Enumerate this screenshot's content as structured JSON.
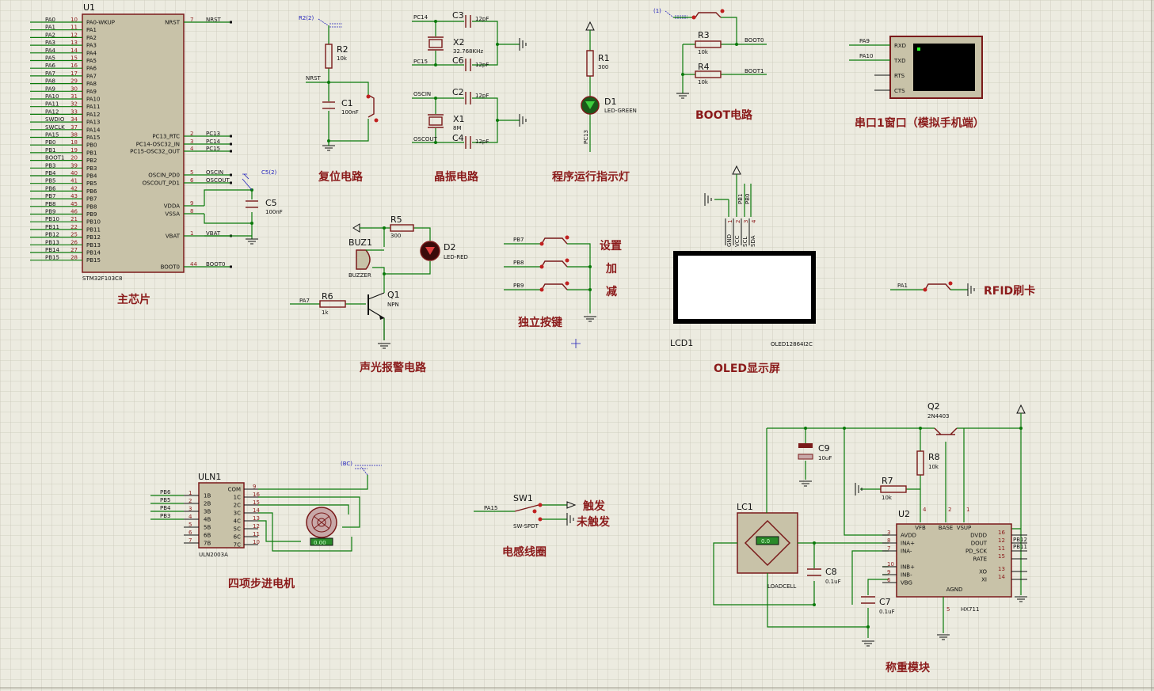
{
  "titles": {
    "main_chip": "主芯片",
    "reset": "复位电路",
    "crystal": "晶振电路",
    "run_led": "程序运行指示灯",
    "boot": "BOOT电路",
    "uart": "串口1窗口（模拟手机端）",
    "alarm": "声光报警电路",
    "keys": "独立按键",
    "oled": "OLED显示屏",
    "rfid": "RFID刷卡",
    "stepper": "四项步进电机",
    "coil": "电感线圈",
    "weigh": "称重模块"
  },
  "mcu": {
    "ref": "U1",
    "part": "STM32F103C8",
    "left_nets": [
      "PA0",
      "PA1",
      "PA2",
      "PA3",
      "PA4",
      "PA5",
      "PA6",
      "PA7",
      "PA8",
      "PA9",
      "PA10",
      "PA11",
      "PA12",
      "SWDIO",
      "SWCLK",
      "PA15",
      "PB0",
      "PB1",
      "BOOT1",
      "PB3",
      "PB4",
      "PB5",
      "PB6",
      "PB7",
      "PB8",
      "PB9",
      "PB10",
      "PB11",
      "PB12",
      "PB13",
      "PB14",
      "PB15"
    ],
    "left_pins": [
      "10",
      "11",
      "12",
      "13",
      "14",
      "15",
      "16",
      "17",
      "29",
      "30",
      "31",
      "32",
      "33",
      "34",
      "37",
      "38",
      "18",
      "19",
      "20",
      "39",
      "40",
      "41",
      "42",
      "43",
      "45",
      "46",
      "21",
      "22",
      "25",
      "26",
      "27",
      "28"
    ],
    "left_labels": [
      "PA0-WKUP",
      "PA1",
      "PA2",
      "PA3",
      "PA4",
      "PA5",
      "PA6",
      "PA7",
      "PA8",
      "PA9",
      "PA10",
      "PA11",
      "PA12",
      "PA13",
      "PA14",
      "PA15",
      "PB0",
      "PB1",
      "PB2",
      "PB3",
      "PB4",
      "PB5",
      "PB6",
      "PB7",
      "PB8",
      "PB9",
      "PB10",
      "PB11",
      "PB12",
      "PB13",
      "PB14",
      "PB15"
    ],
    "right": [
      {
        "label": "NRST",
        "pin": "7",
        "net": "NRST"
      },
      {
        "label": "PC13_RTC",
        "pin": "2",
        "net": "PC13"
      },
      {
        "label": "PC14-OSC32_IN",
        "pin": "3",
        "net": "PC14"
      },
      {
        "label": "PC15-OSC32_OUT",
        "pin": "4",
        "net": "PC15"
      },
      {
        "label": "OSCIN_PD0",
        "pin": "5",
        "net": "OSCIN"
      },
      {
        "label": "OSCOUT_PD1",
        "pin": "6",
        "net": "OSCOUT"
      },
      {
        "label": "VDDA",
        "pin": "9",
        "net": ""
      },
      {
        "label": "VSSA",
        "pin": "8",
        "net": ""
      },
      {
        "label": "VBAT",
        "pin": "1",
        "net": "VBAT"
      },
      {
        "label": "BOOT0",
        "pin": "44",
        "net": "BOOT0"
      }
    ]
  },
  "c5": {
    "ref": "C5",
    "val": "100nF",
    "probe": "C5(2)"
  },
  "reset": {
    "r_ref": "R2",
    "r_val": "10k",
    "c_ref": "C1",
    "c_val": "100nF",
    "net": "NRST",
    "probe": "R2(2)"
  },
  "crystal": {
    "c3": "C3",
    "c3v": "12pF",
    "x2": "X2",
    "x2v": "32.768KHz",
    "c6": "C6",
    "c6v": "12pF",
    "c2": "C2",
    "c2v": "12pF",
    "x1": "X1",
    "x1v": "8M",
    "c4": "C4",
    "c4v": "12pF",
    "n1": "PC14",
    "n2": "PC15",
    "n3": "OSCIN",
    "n4": "OSCOUT"
  },
  "runled": {
    "r_ref": "R1",
    "r_val": "300",
    "d_ref": "D1",
    "d_val": "LED-GREEN",
    "net": "PC13"
  },
  "boot": {
    "probe": "(1)",
    "r3": "R3",
    "r3v": "10k",
    "r4": "R4",
    "r4v": "10k",
    "n1": "BOOT0",
    "n2": "BOOT1"
  },
  "uart": {
    "n1": "PA9",
    "n2": "PA10",
    "pins": [
      "RXD",
      "TXD",
      "RTS",
      "CTS"
    ]
  },
  "alarm": {
    "buz": "BUZ1",
    "buz_val": "BUZZER",
    "r5": "R5",
    "r5v": "300",
    "d2": "D2",
    "d2v": "LED-RED",
    "r6": "R6",
    "r6v": "1k",
    "q1": "Q1",
    "q1v": "NPN",
    "net": "PA7"
  },
  "keys": {
    "nets": [
      "PB7",
      "PB8",
      "PB9"
    ],
    "labels": [
      "设置",
      "加",
      "减"
    ]
  },
  "oled": {
    "ref": "LCD1",
    "part": "OLED12864I2C",
    "pins": [
      "GND",
      "VCC",
      "SCL",
      "SDA"
    ],
    "nums": [
      "1",
      "2",
      "3",
      "4"
    ],
    "nets": [
      "PB1",
      "PB0"
    ]
  },
  "rfid": {
    "net": "PA1"
  },
  "uln": {
    "ref": "ULN1",
    "part": "ULN2003A",
    "probe": "(BC)",
    "nets": [
      "PB6",
      "PB5",
      "PB4",
      "PB3"
    ],
    "left": [
      {
        "n": "1",
        "l": "1B"
      },
      {
        "n": "2",
        "l": "2B"
      },
      {
        "n": "3",
        "l": "3B"
      },
      {
        "n": "4",
        "l": "4B"
      },
      {
        "n": "5",
        "l": "5B"
      },
      {
        "n": "6",
        "l": "6B"
      },
      {
        "n": "7",
        "l": "7B"
      }
    ],
    "right": [
      {
        "n": "9",
        "l": "COM"
      },
      {
        "n": "16",
        "l": "1C"
      },
      {
        "n": "15",
        "l": "2C"
      },
      {
        "n": "14",
        "l": "3C"
      },
      {
        "n": "13",
        "l": "4C"
      },
      {
        "n": "12",
        "l": "5C"
      },
      {
        "n": "11",
        "l": "6C"
      },
      {
        "n": "10",
        "l": "7C"
      }
    ],
    "motor_readout": "0.00"
  },
  "sw1": {
    "ref": "SW1",
    "part": "SW-SPDT",
    "net": "PA15",
    "a": "触发",
    "b": "未触发"
  },
  "weigh": {
    "q2": "Q2",
    "q2v": "2N4403",
    "r8": "R8",
    "r8v": "10k",
    "r7": "R7",
    "r7v": "10k",
    "c9": "C9",
    "c9v": "10uF",
    "c8": "C8",
    "c8v": "0.1uF",
    "c7": "C7",
    "c7v": "0.1uF",
    "lc": "LC1",
    "lcv": "LOADCELL",
    "lc_readout": "0.0",
    "u2": "U2",
    "u2v": "HX711",
    "top_pins": [
      {
        "n": "4",
        "l": "VFB"
      },
      {
        "n": "2",
        "l": "BASE"
      },
      {
        "n": "1",
        "l": "VSUP"
      }
    ],
    "left_pins": [
      {
        "n": "3",
        "l": "AVDD"
      },
      {
        "n": "8",
        "l": "INA+"
      },
      {
        "n": "7",
        "l": "INA-"
      },
      {
        "n": "10",
        "l": "INB+"
      },
      {
        "n": "9",
        "l": "INB-"
      },
      {
        "n": "6",
        "l": "VBG"
      }
    ],
    "right_pins": [
      {
        "n": "16",
        "l": "DVDD"
      },
      {
        "n": "12",
        "l": "DOUT"
      },
      {
        "n": "11",
        "l": "PD_SCK"
      },
      {
        "n": "15",
        "l": "RATE"
      },
      {
        "n": "13",
        "l": "XO"
      },
      {
        "n": "14",
        "l": "XI"
      }
    ],
    "bot_pin": {
      "n": "5",
      "l": "AGND"
    },
    "nets": [
      "PB12",
      "PB11"
    ]
  }
}
